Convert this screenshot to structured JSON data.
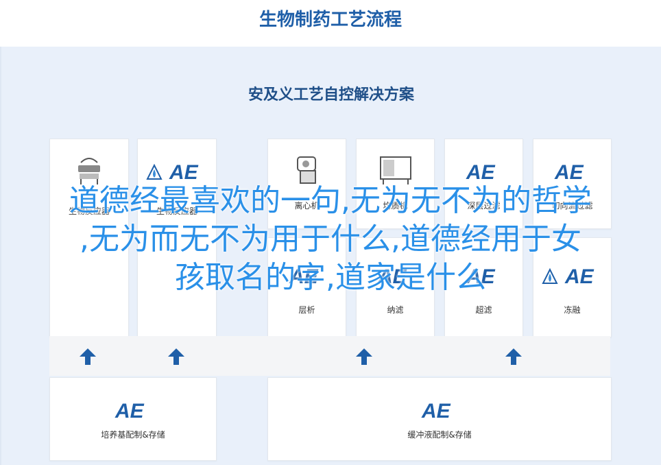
{
  "header": {
    "title": "生物制药工艺流程"
  },
  "panel": {
    "title": "安及义工艺自控解决方案"
  },
  "cards_top": [
    {
      "label": "生物反应器",
      "icon": "bioreactor-icon"
    },
    {
      "label": "生物反应器",
      "icon": "ae-logo-icon"
    },
    {
      "label": "离心机",
      "icon": "centrifuge-icon"
    },
    {
      "label": "均质机",
      "icon": "homogenizer-icon"
    },
    {
      "label": "深层过滤",
      "icon": "ae-logo-icon"
    },
    {
      "label": "切向流过滤",
      "icon": "ae-logo-icon"
    }
  ],
  "cards_mid": [
    {
      "label": "层析",
      "icon": "ae-logo-icon"
    },
    {
      "label": "纳滤",
      "icon": "ae-logo-icon"
    },
    {
      "label": "超滤",
      "icon": "ae-logo-icon"
    },
    {
      "label": "冻融",
      "icon": "ae-logo-icon"
    }
  ],
  "cards_bottom": [
    {
      "label": "培养基配制&存储",
      "icon": "ae-logo-icon"
    },
    {
      "label": "缓冲液配制&存储",
      "icon": "ae-logo-icon"
    }
  ],
  "overlay": {
    "line1": "道德经最喜欢的一句,无为无不为的哲学",
    "line2": ",无为而无不为用于什么,道德经用于女",
    "line3": "孩取名的字,道家是什么"
  },
  "colors": {
    "brand": "#1f5fa8",
    "overlay": "#2a90e8",
    "panel": "#e9f0fa"
  }
}
